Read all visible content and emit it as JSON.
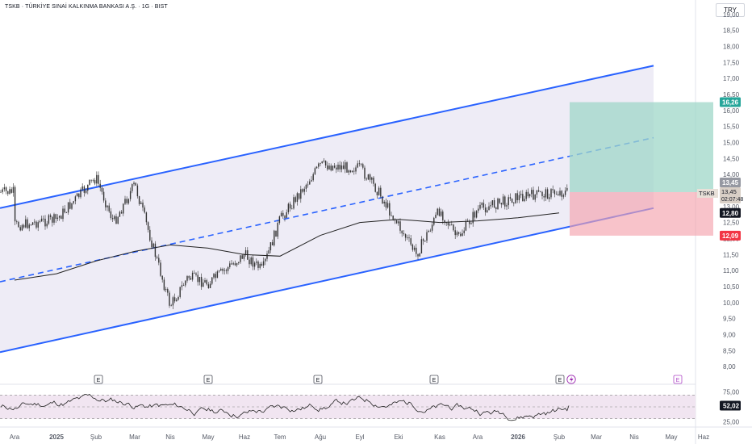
{
  "header": {
    "title": "TSKB · TÜRKİYE SINAİ KALKINMA BANKASI A.Ş. · 1G · BIST",
    "currency_button": "TRY"
  },
  "colors": {
    "channel": "#2962ff",
    "channel_fill": "#ebe9f5",
    "profit_zone": "#9fd7c8",
    "loss_zone": "#f5a3ad",
    "candle": "#333333",
    "moving_average": "#222222",
    "rsi_band": "#f1e5f1",
    "rsi_line": "#222222",
    "badge_profit": "#26a69a",
    "badge_loss": "#f23645"
  },
  "chart_data": [
    {
      "type": "line",
      "subtype": "candlestick",
      "symbol": "TSKB",
      "x_tick_labels": [
        "Ara",
        "2025",
        "Şub",
        "Mar",
        "Nis",
        "May",
        "Haz",
        "Tem",
        "Ağu",
        "Eyl",
        "Eki",
        "Kas",
        "Ara",
        "2026",
        "Şub",
        "Mar",
        "Nis",
        "May",
        "Haz"
      ],
      "y_tick_labels": [
        "8,00",
        "8,50",
        "9,00",
        "9,50",
        "10,00",
        "10,50",
        "11,00",
        "11,50",
        "12,00",
        "12,50",
        "13,00",
        "13,50",
        "14,00",
        "14,50",
        "15,00",
        "15,50",
        "16,00",
        "16,50",
        "17,00",
        "17,50",
        "18,00",
        "18,50",
        "19,00"
      ],
      "ylim": [
        7.6,
        19.35
      ],
      "grid": false,
      "approx_close_path": [
        [
          "Ara",
          12.4
        ],
        [
          "2025",
          12.6
        ],
        [
          "Şub",
          13.9
        ],
        [
          "Şub",
          12.5
        ],
        [
          "Mar",
          13.7
        ],
        [
          "Nis",
          9.9
        ],
        [
          "Nis",
          10.8
        ],
        [
          "May",
          10.6
        ],
        [
          "Haz",
          11.5
        ],
        [
          "Haz",
          11.0
        ],
        [
          "Tem",
          12.6
        ],
        [
          "Ağu",
          14.3
        ],
        [
          "Eyl",
          14.2
        ],
        [
          "Eyl",
          13.5
        ],
        [
          "Eki",
          12.4
        ],
        [
          "Eki",
          11.5
        ],
        [
          "Kas",
          12.9
        ],
        [
          "Kas",
          12.0
        ],
        [
          "Ara",
          12.9
        ],
        [
          "2026",
          13.3
        ],
        [
          "Şub",
          13.45
        ]
      ],
      "moving_average_path": [
        [
          "Ara",
          10.7
        ],
        [
          "2025",
          10.9
        ],
        [
          "Şub",
          11.3
        ],
        [
          "Mar",
          11.6
        ],
        [
          "Nis",
          11.8
        ],
        [
          "May",
          11.7
        ],
        [
          "Haz",
          11.5
        ],
        [
          "Tem",
          11.45
        ],
        [
          "Ağu",
          12.1
        ],
        [
          "Eyl",
          12.5
        ],
        [
          "Eki",
          12.6
        ],
        [
          "Kas",
          12.5
        ],
        [
          "Ara",
          12.55
        ],
        [
          "2026",
          12.65
        ],
        [
          "Şub",
          12.8
        ]
      ],
      "channel": {
        "upper": {
          "start": [
            "Ara",
            12.95
          ],
          "end": [
            "May",
            17.4
          ]
        },
        "middle": {
          "start": [
            "Ara",
            10.65
          ],
          "end": [
            "May",
            15.15
          ]
        },
        "lower": {
          "start": [
            "Ara",
            8.45
          ],
          "end": [
            "May",
            12.95
          ]
        }
      },
      "position": {
        "entry": 13.45,
        "target": 16.26,
        "stop": 12.09
      },
      "price_badges": [
        {
          "kind": "target",
          "text": "16,26"
        },
        {
          "kind": "price",
          "text": "13,45"
        },
        {
          "kind": "symbol",
          "text": "TSKB",
          "value": "13,45",
          "countdown": "02:07:48"
        },
        {
          "kind": "ma",
          "text": "12,80"
        },
        {
          "kind": "stop",
          "text": "12,09"
        }
      ],
      "event_markers": {
        "label": "E",
        "months": [
          "Şub",
          "Nis",
          "Ağu",
          "Eki",
          "Şub",
          "May"
        ]
      }
    },
    {
      "type": "line",
      "indicator": "RSI",
      "y_tick_labels": [
        "25,00",
        "50,00",
        "75,00"
      ],
      "band": [
        30,
        70
      ],
      "ylim": [
        20,
        80
      ],
      "current_value": 52.02,
      "current_label": "52,02"
    }
  ]
}
